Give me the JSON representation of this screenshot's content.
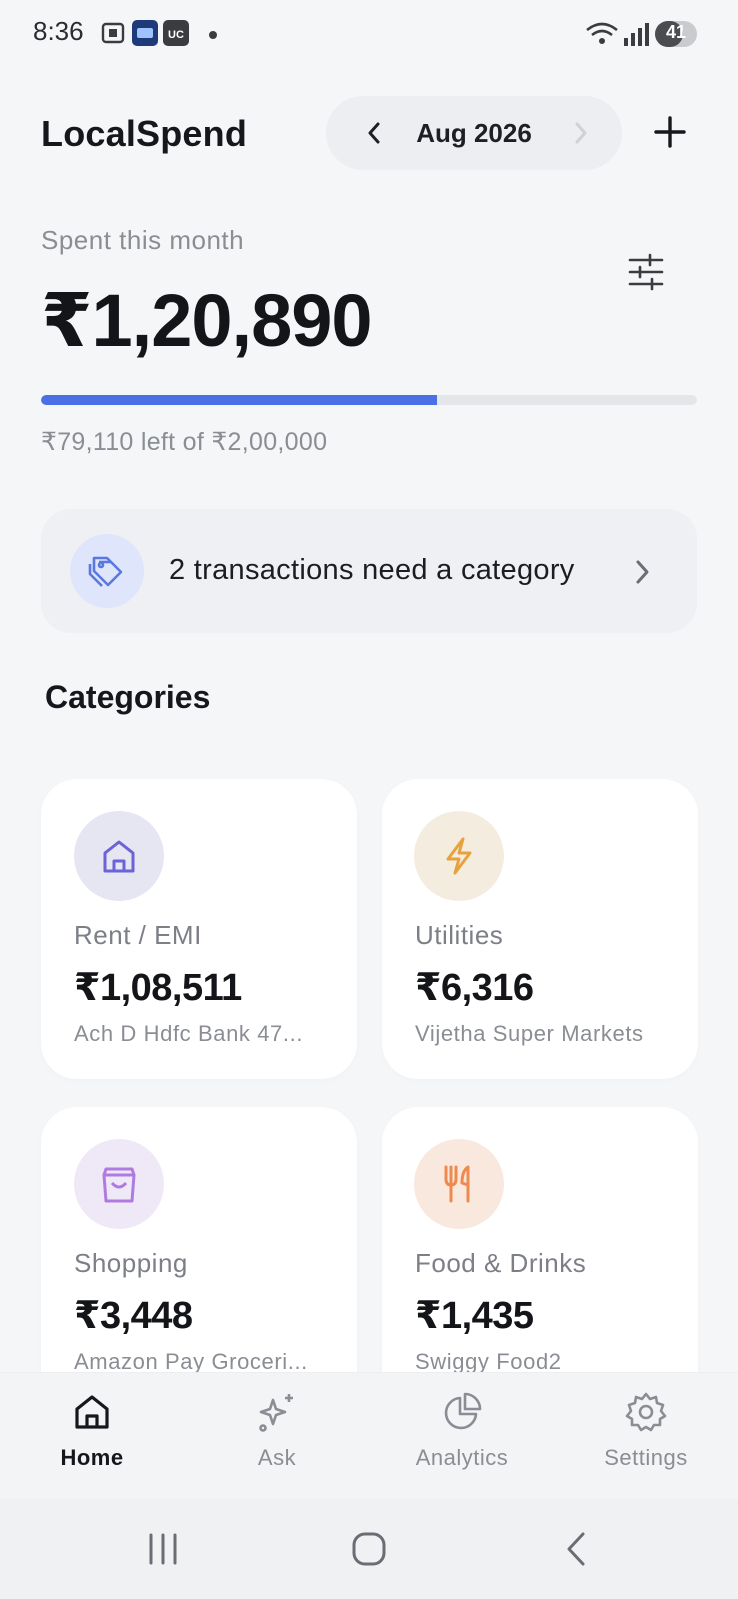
{
  "status_bar": {
    "time": "8:36",
    "battery": "41",
    "icons": [
      "screenshot-icon",
      "app-notification-icon",
      "uc-icon",
      "wifi-icon",
      "signal-icon"
    ]
  },
  "header": {
    "title": "LocalSpend",
    "month": "Aug 2026",
    "prev_icon": "chevron-left-icon",
    "next_icon": "chevron-right-icon",
    "add_icon": "plus-icon"
  },
  "summary": {
    "label": "Spent this month",
    "amount": "₹1,20,890",
    "budget_text": "₹79,110 left of ₹2,00,000",
    "progress_fraction": 0.604,
    "accent_color": "#4c6fe6",
    "filter_icon": "sliders-icon"
  },
  "alert": {
    "text": "2 transactions need a category",
    "icon": "tag-icon"
  },
  "categories": {
    "title": "Categories",
    "items": [
      {
        "name": "Rent / EMI",
        "amount": "₹1,08,511",
        "merchant": "Ach D Hdfc Bank 47...",
        "icon": "home-icon",
        "color": "#6b63d6",
        "bg": "#e6e6f2"
      },
      {
        "name": "Utilities",
        "amount": "₹6,316",
        "merchant": "Vijetha Super Markets",
        "icon": "bolt-icon",
        "color": "#e6a23c",
        "bg": "#f5ece0"
      },
      {
        "name": "Shopping",
        "amount": "₹3,448",
        "merchant": "Amazon Pay Groceri...",
        "icon": "bag-icon",
        "color": "#b07be0",
        "bg": "#efe8f6"
      },
      {
        "name": "Food & Drinks",
        "amount": "₹1,435",
        "merchant": "Swiggy Food2",
        "icon": "fork-knife-icon",
        "color": "#ef8a4c",
        "bg": "#f8e8de"
      }
    ]
  },
  "bottom_nav": {
    "items": [
      {
        "label": "Home",
        "icon": "home-icon",
        "active": true
      },
      {
        "label": "Ask",
        "icon": "sparkle-icon",
        "active": false
      },
      {
        "label": "Analytics",
        "icon": "pie-chart-icon",
        "active": false
      },
      {
        "label": "Settings",
        "icon": "gear-icon",
        "active": false
      }
    ]
  },
  "system_nav": {
    "icons": [
      "recents-icon",
      "home-circle-icon",
      "back-icon"
    ]
  }
}
